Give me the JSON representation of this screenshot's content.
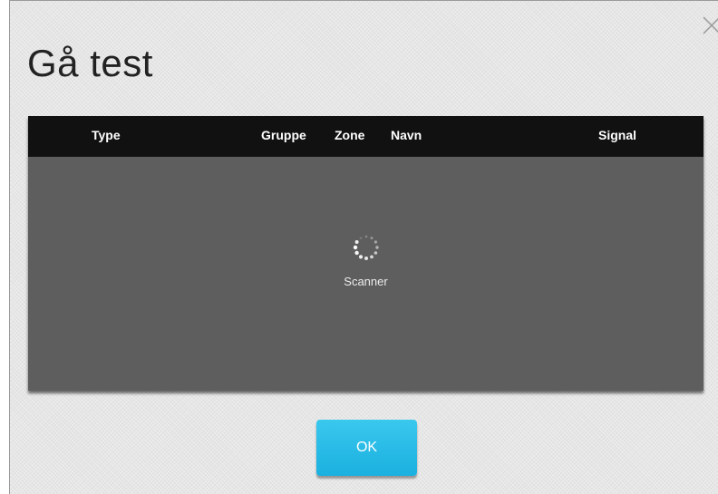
{
  "dialog": {
    "title": "Gå test",
    "close_icon": "close-x-icon"
  },
  "table": {
    "columns": [
      "Type",
      "Gruppe",
      "Zone",
      "Navn",
      "Signal"
    ],
    "rows": []
  },
  "loading": {
    "icon": "spinner-icon",
    "text": "Scanner"
  },
  "footer": {
    "ok_label": "OK"
  },
  "colors": {
    "accent": "#1ab0df",
    "header_bg": "#111111",
    "panel_bg": "#5e5e5e"
  }
}
